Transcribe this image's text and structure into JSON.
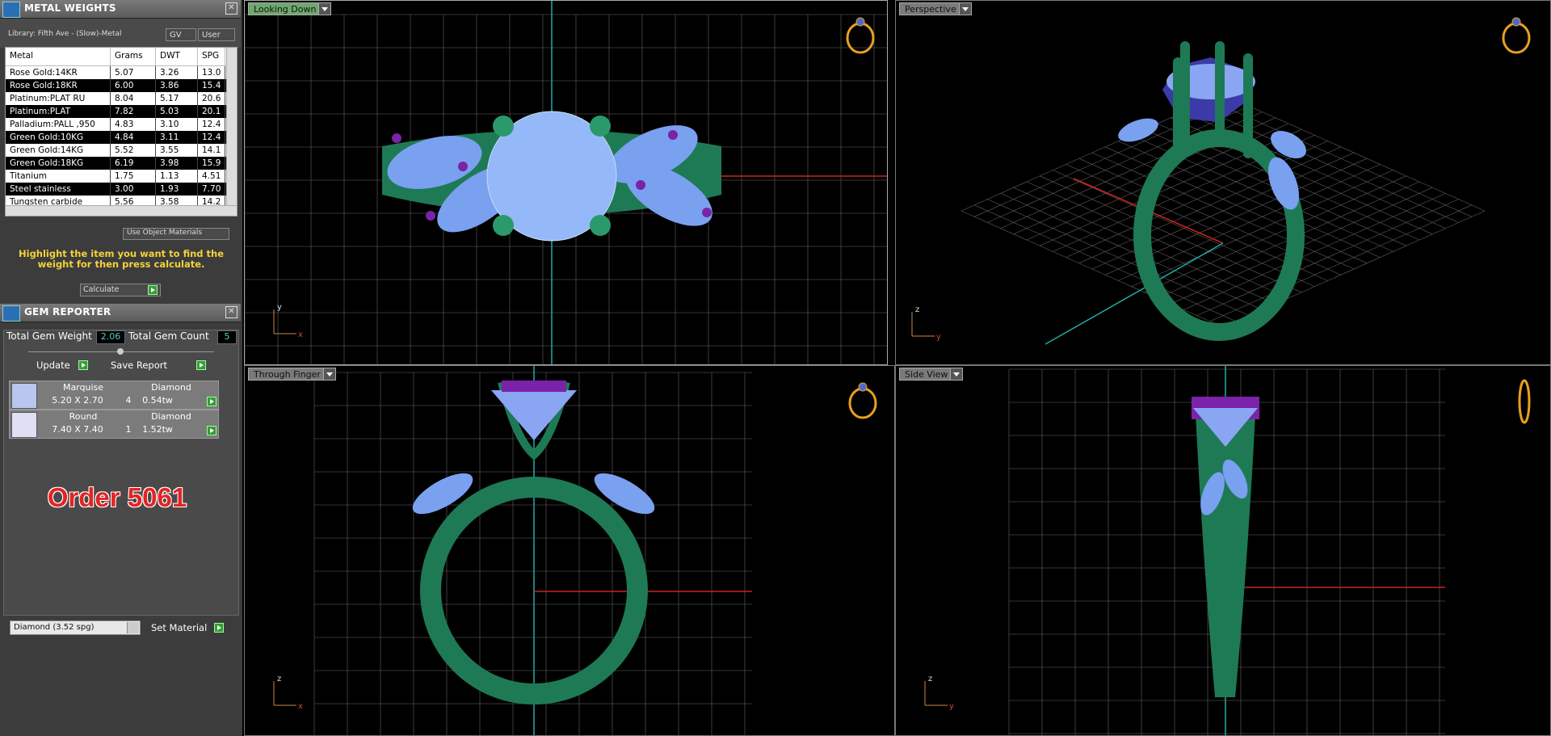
{
  "metal_weights": {
    "title": "METAL WEIGHTS",
    "library": "Library: Fifth Ave - (Slow)-Metal",
    "gv_label": "GV",
    "user_label": "User",
    "columns": [
      "Metal",
      "Grams",
      "DWT",
      "SPG"
    ],
    "rows": [
      [
        "Rose Gold:14KR",
        "5.07",
        "3.26",
        "13.0"
      ],
      [
        "Rose Gold:18KR",
        "6.00",
        "3.86",
        "15.4"
      ],
      [
        "Platinum:PLAT RU",
        "8.04",
        "5.17",
        "20.6"
      ],
      [
        "Platinum:PLAT",
        "7.82",
        "5.03",
        "20.1"
      ],
      [
        "Palladium:PALL ,950",
        "4.83",
        "3.10",
        "12.4"
      ],
      [
        "Green Gold:10KG",
        "4.84",
        "3.11",
        "12.4"
      ],
      [
        "Green Gold:14KG",
        "5.52",
        "3.55",
        "14.1"
      ],
      [
        "Green Gold:18KG",
        "6.19",
        "3.98",
        "15.9"
      ],
      [
        "Titanium",
        "1.75",
        "1.13",
        "4.51"
      ],
      [
        "Steel stainless",
        "3.00",
        "1.93",
        "7.70"
      ],
      [
        "Tungsten carbide",
        "5.56",
        "3.58",
        "14.2"
      ]
    ],
    "use_object_materials": "Use Object Materials",
    "hint": "Highlight the item you want to find the weight for then press calculate.",
    "calculate": "Calculate"
  },
  "gem_reporter": {
    "title": "GEM REPORTER",
    "total_weight_label": "Total Gem Weight",
    "total_weight": "2.06",
    "total_count_label": "Total Gem Count",
    "total_count": "5",
    "update": "Update",
    "save_report": "Save Report",
    "gems": [
      {
        "shape": "Marquise",
        "material": "Diamond",
        "size": "5.20 X 2.70",
        "count": "4",
        "weight": "0.54tw"
      },
      {
        "shape": "Round",
        "material": "Diamond",
        "size": "7.40 X 7.40",
        "count": "1",
        "weight": "1.52tw"
      }
    ],
    "order": "Order 5061",
    "material_select": "Diamond     (3.52 spg)",
    "set_material": "Set Material"
  },
  "viewports": {
    "top_left": "Looking Down",
    "top_right": "Perspective",
    "bottom_left": "Through Finger",
    "bottom_right": "Side View"
  },
  "axes": {
    "x": "x",
    "y": "y",
    "z": "z"
  },
  "colors": {
    "metal": "#1e7a55",
    "gem": "#7aa0f0",
    "prong": "#7a22a8",
    "grid": "#888888",
    "accent": "#f4d23a"
  }
}
